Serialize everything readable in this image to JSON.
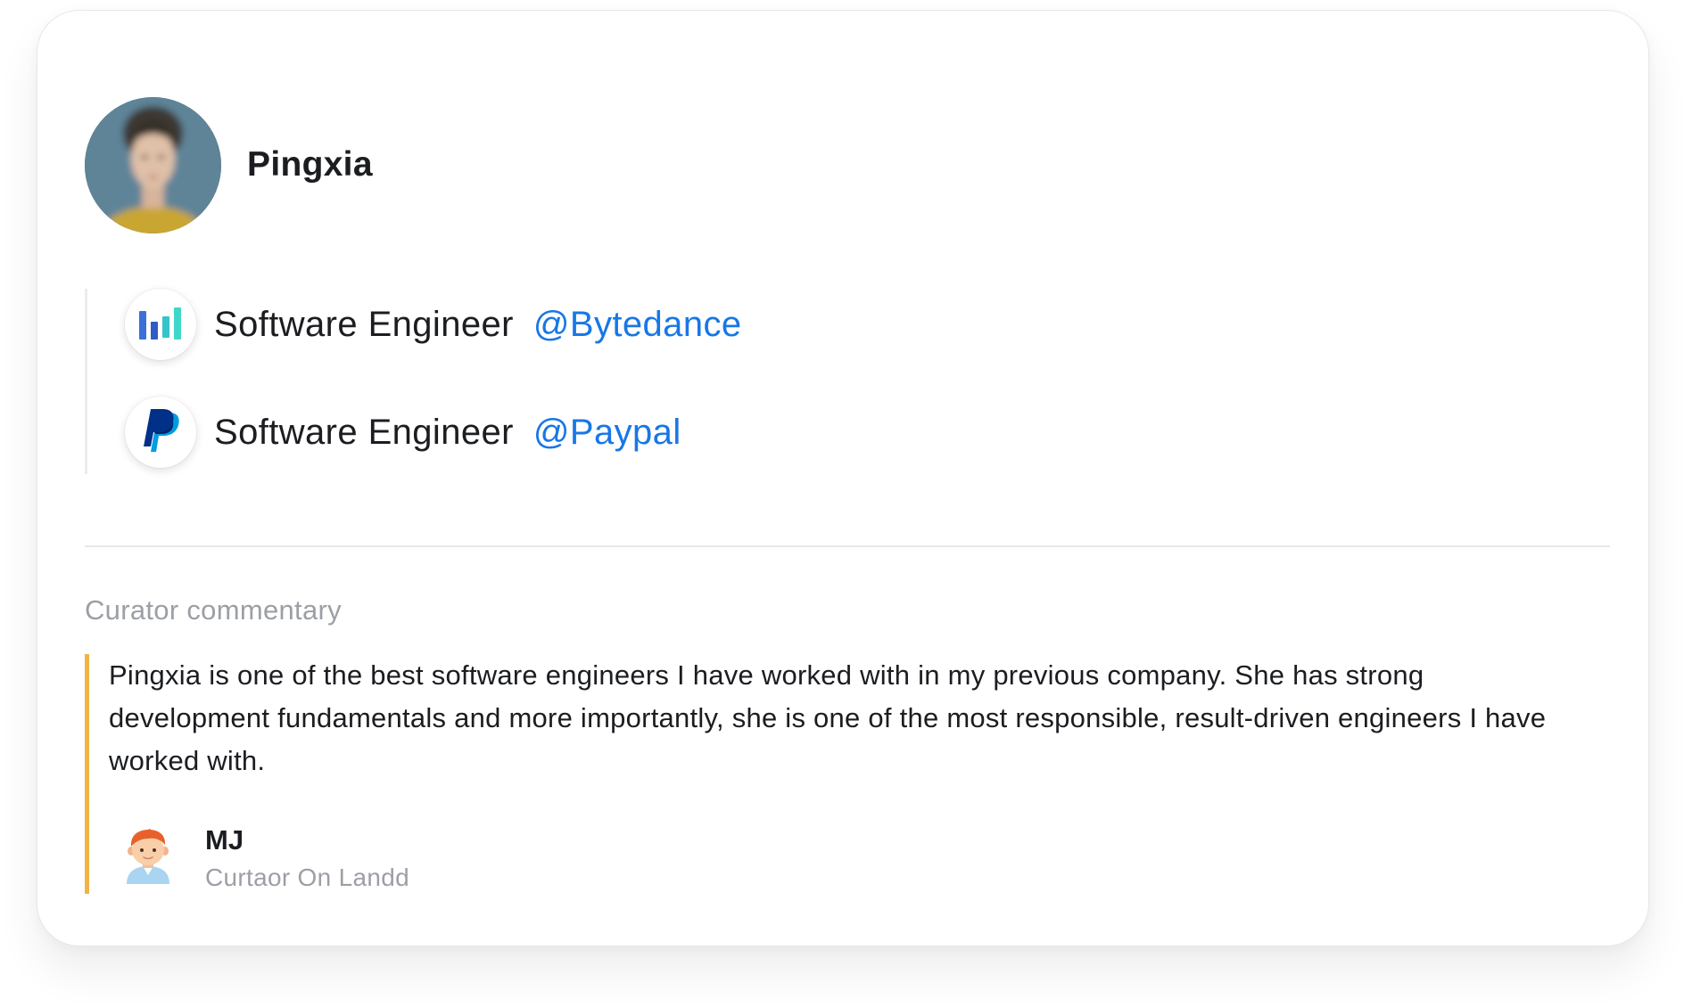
{
  "profile": {
    "name": "Pingxia",
    "avatar_icon": "profile-photo"
  },
  "experience": [
    {
      "role": "Software Engineer",
      "company": "@Bytedance",
      "logo_icon": "bytedance-logo"
    },
    {
      "role": "Software Engineer",
      "company": "@Paypal",
      "logo_icon": "paypal-logo"
    }
  ],
  "commentary": {
    "heading": "Curator commentary",
    "text": "Pingxia is one of the best software engineers I have worked with in my previous company. She has strong development fundamentals and more importantly, she is one of the most responsible, result-driven engineers I have worked with.",
    "curator": {
      "name": "MJ",
      "title": "Curtaor On Landd",
      "avatar_icon": "curator-avatar"
    }
  },
  "colors": {
    "link": "#1877e6",
    "quote_accent": "#f0b446",
    "muted_text": "#9c9fa5",
    "text": "#1b1d21"
  }
}
